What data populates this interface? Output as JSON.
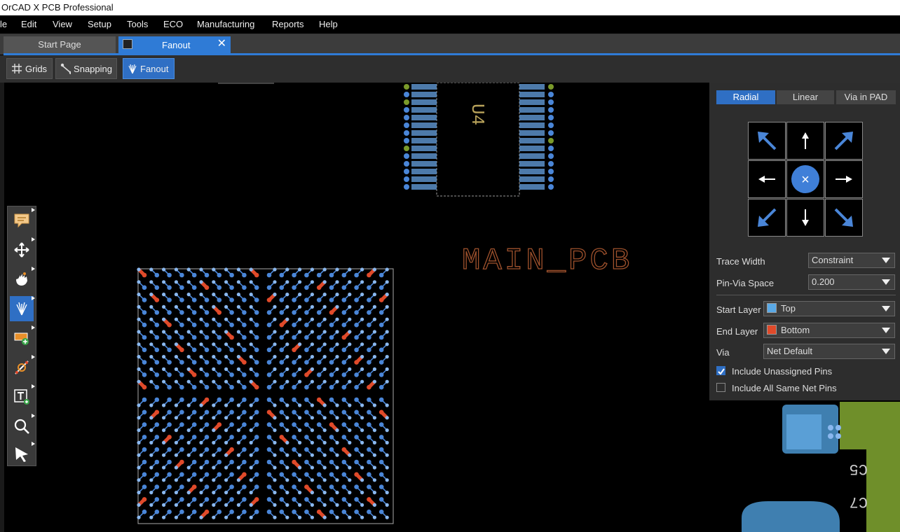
{
  "window": {
    "title": "OrCAD X PCB Professional"
  },
  "menu": [
    "le",
    "Edit",
    "View",
    "Setup",
    "Tools",
    "ECO",
    "Manufacturing",
    "Reports",
    "Help"
  ],
  "tabs": {
    "start": "Start Page",
    "fanout": "Fanout"
  },
  "toolbar": {
    "grids": "Grids",
    "snapping": "Snapping",
    "fanout": "Fanout"
  },
  "canvas": {
    "board_label": "MAIN_PCB",
    "ref_u4": "U4",
    "ref_c5": "C5",
    "ref_c7": "C7"
  },
  "panel": {
    "modes": [
      "Radial",
      "Linear",
      "Via in PAD"
    ],
    "active_mode": "Radial",
    "center_symbol": "×",
    "trace_width_label": "Trace Width",
    "trace_width_value": "Constraint",
    "pin_via_label": "Pin-Via Space",
    "pin_via_value": "0.200",
    "start_layer_label": "Start Layer",
    "start_layer_value": "Top",
    "start_layer_color": "#5aa9e6",
    "end_layer_label": "End Layer",
    "end_layer_value": "Bottom",
    "end_layer_color": "#e04a2a",
    "via_label": "Via",
    "via_value": "Net Default",
    "include_unassigned": {
      "label": "Include Unassigned Pins",
      "checked": true
    },
    "include_same_net": {
      "label": "Include All Same Net Pins",
      "checked": false
    }
  },
  "colors": {
    "accent": "#2f7bd6",
    "pin_blue": "#4a86d8",
    "net_red": "#e04a2a",
    "net_orange": "#e8902a",
    "net_green": "#7a9a2a",
    "board_text": "#a0522d"
  }
}
